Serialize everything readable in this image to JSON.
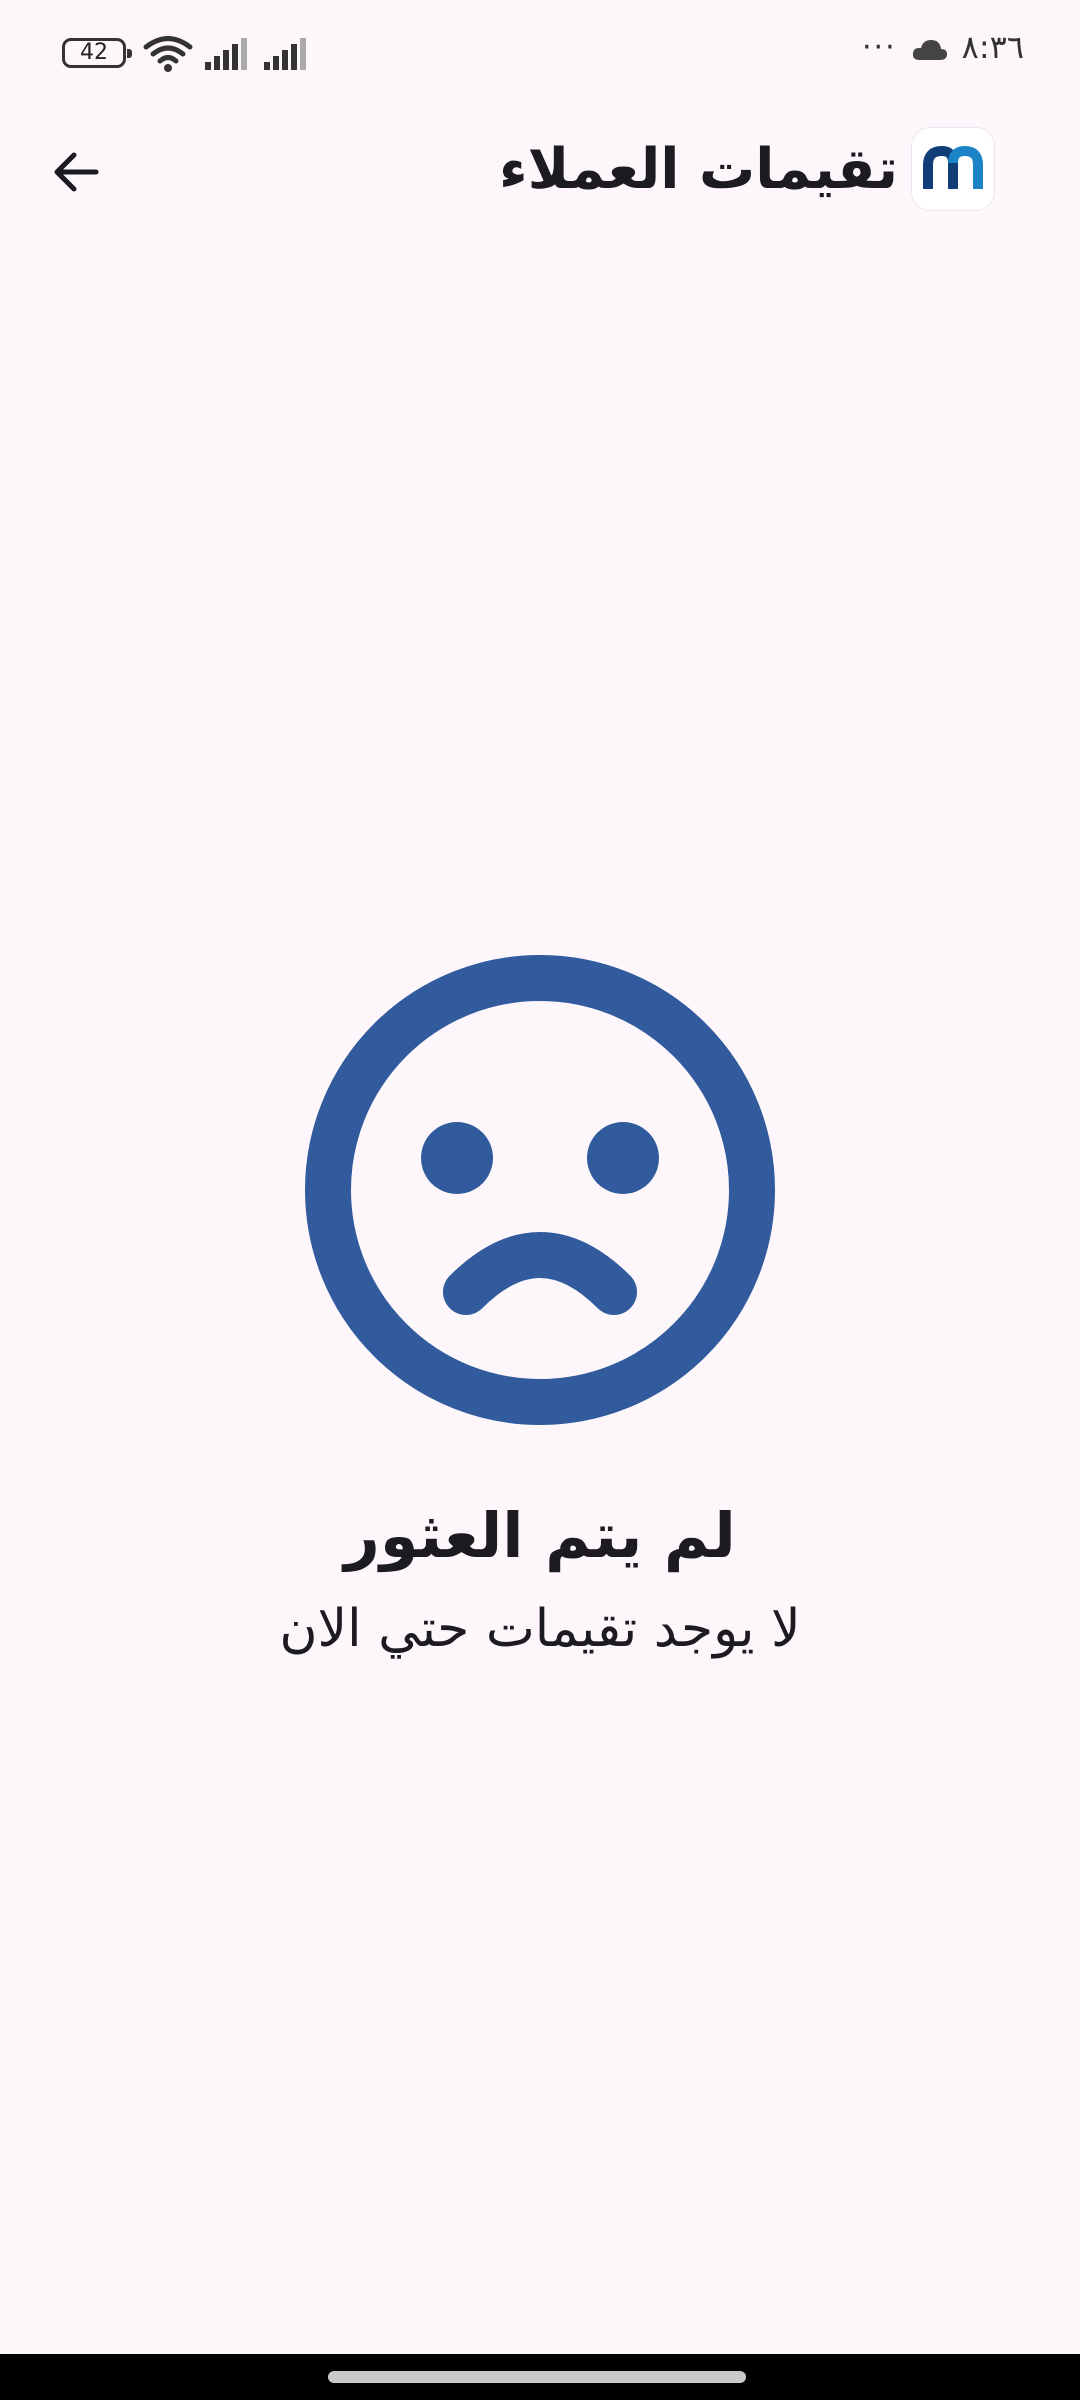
{
  "status_bar": {
    "battery_level": "42",
    "time": "٨:٣٦",
    "more_indicator": "···",
    "icons": [
      "battery-icon",
      "wifi-icon",
      "signal-icon",
      "signal-icon",
      "more-icon",
      "cloud-icon"
    ]
  },
  "app_bar": {
    "title": "تقيمات العملاء",
    "back_icon": "arrow-left-icon",
    "logo_icon": "app-logo-icon"
  },
  "empty_state": {
    "icon": "sad-face-icon",
    "title": "لم يتم العثور",
    "subtitle": "لا يوجد تقيمات حتي الان"
  },
  "colors": {
    "background": "#fdf7fc",
    "accent": "#315b9d",
    "logo_dark": "#123e78",
    "logo_light": "#1b83c6",
    "text": "#1c1b1f"
  }
}
